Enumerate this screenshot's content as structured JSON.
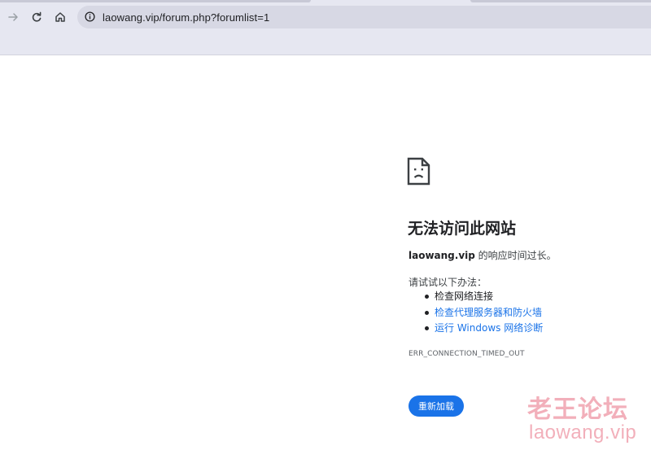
{
  "browser": {
    "url": "laowang.vip/forum.php?forumlist=1",
    "icons": {
      "forward": "arrow-right-icon",
      "reload": "reload-icon",
      "home": "home-icon",
      "site_info": "info-icon"
    }
  },
  "error_page": {
    "icon": "sad-document-icon",
    "title": "无法访问此网站",
    "host": "laowang.vip",
    "description_suffix": " 的响应时间过长。",
    "suggestions_heading": "请试试以下办法：",
    "suggestions": [
      {
        "text": "检查网络连接",
        "is_link": false
      },
      {
        "text": "检查代理服务器和防火墙",
        "is_link": true
      },
      {
        "text": "运行 Windows 网络诊断",
        "is_link": true
      }
    ],
    "error_code": "ERR_CONNECTION_TIMED_OUT",
    "reload_label": "重新加载"
  },
  "watermark": {
    "title": "老王论坛",
    "url": "laowang.vip"
  },
  "colors": {
    "chrome_bg": "#e6e7f1",
    "omnibox_bg": "#d7d8e4",
    "link": "#1a73e8",
    "button": "#1a73e8",
    "watermark": "#e86e82"
  }
}
